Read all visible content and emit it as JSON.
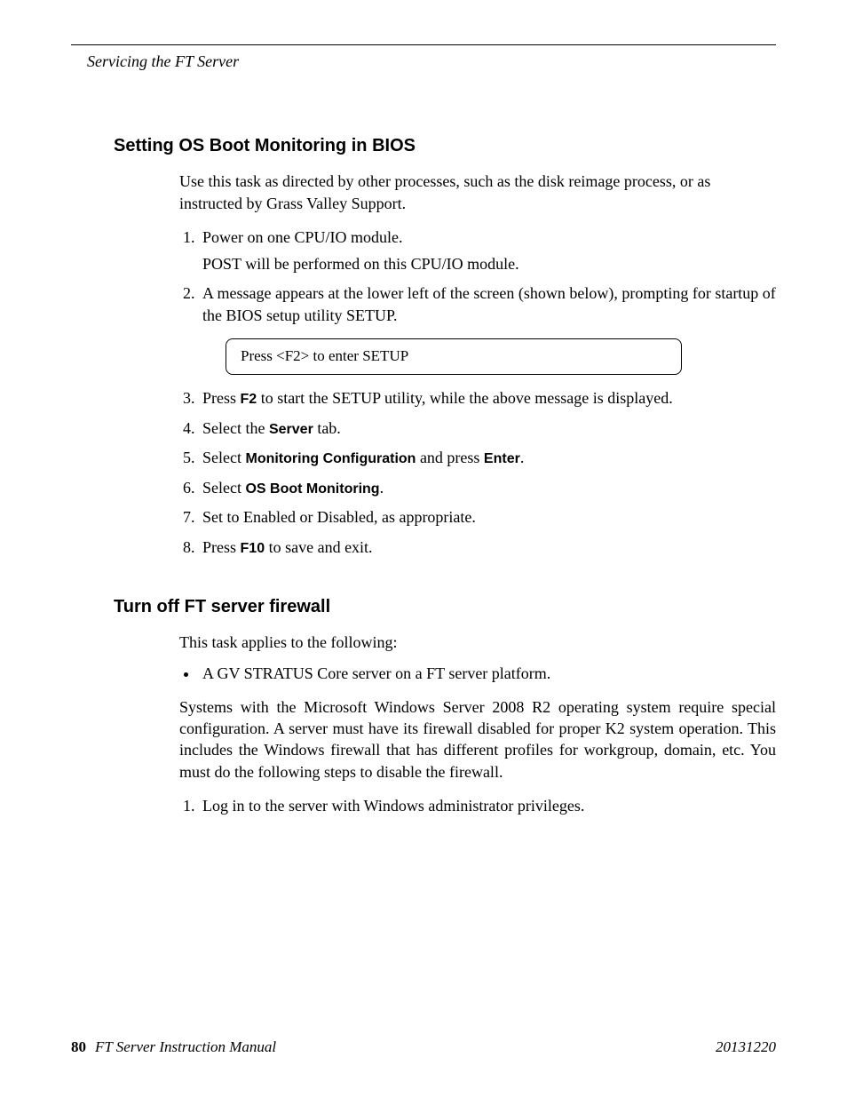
{
  "header": {
    "running_title": "Servicing the FT Server"
  },
  "section1": {
    "heading": "Setting OS Boot Monitoring in BIOS",
    "intro": "Use this task as directed by other processes, such as the disk reimage process, or as instructed by Grass Valley Support.",
    "step1": "Power on one CPU/IO module.",
    "step1_sub": "POST will be performed on this CPU/IO module.",
    "step2": "A message appears at the lower left of the screen (shown below), prompting for startup of the BIOS setup utility SETUP.",
    "code_box": "Press <F2> to enter SETUP",
    "step3_pre": "Press ",
    "step3_key": "F2",
    "step3_post": " to start the SETUP utility, while the above message is displayed.",
    "step4_pre": "Select the ",
    "step4_key": "Server",
    "step4_post": " tab.",
    "step5_pre": "Select ",
    "step5_key1": "Monitoring Configuration",
    "step5_mid": " and press ",
    "step5_key2": "Enter",
    "step5_post": ".",
    "step6_pre": "Select ",
    "step6_key": "OS Boot Monitoring",
    "step6_post": ".",
    "step7": "Set to Enabled or Disabled, as appropriate.",
    "step8_pre": "Press ",
    "step8_key": "F10",
    "step8_post": " to save and exit."
  },
  "section2": {
    "heading": "Turn off FT server firewall",
    "intro": "This task applies to the following:",
    "bullet1": "A GV STRATUS Core server on a FT server platform.",
    "para": "Systems with the Microsoft Windows Server 2008 R2 operating system require special configuration. A server must have its firewall disabled for proper K2 system operation. This includes the Windows firewall that has different profiles for workgroup, domain, etc. You must do the following steps to disable the firewall.",
    "step1": "Log in to the server with Windows administrator privileges."
  },
  "footer": {
    "page_number": "80",
    "manual_title": "FT Server Instruction Manual",
    "date": "20131220"
  }
}
